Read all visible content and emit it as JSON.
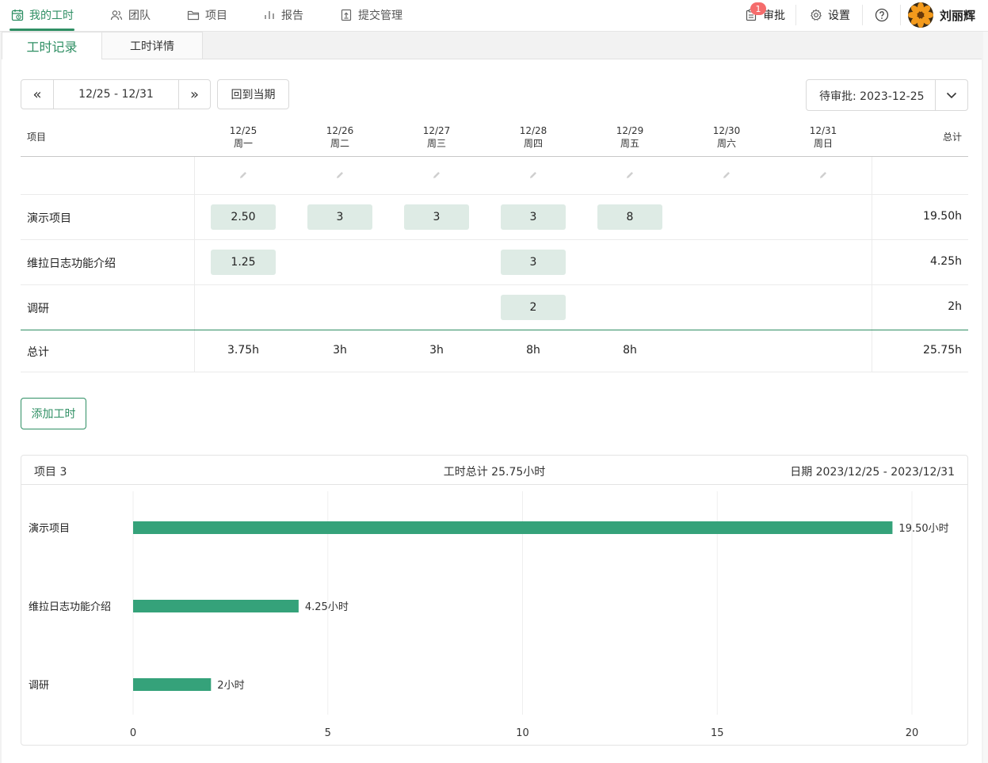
{
  "nav": {
    "items": [
      {
        "label": "我的工时",
        "icon": "calendar-clock-icon",
        "active": true
      },
      {
        "label": "团队",
        "icon": "users-icon"
      },
      {
        "label": "项目",
        "icon": "folder-icon"
      },
      {
        "label": "报告",
        "icon": "bar-chart-icon"
      },
      {
        "label": "提交管理",
        "icon": "submit-doc-icon"
      }
    ],
    "right": {
      "approval_label": "审批",
      "approval_badge": "1",
      "settings_label": "设置",
      "user_name": "刘丽辉"
    }
  },
  "tabs": [
    "工时记录",
    "工时详情"
  ],
  "toolbar": {
    "prev": "«",
    "range": "12/25 - 12/31",
    "next": "»",
    "current_label": "回到当期",
    "pending_label": "待审批: 2023-12-25"
  },
  "table": {
    "project_header": "项目",
    "total_header": "总计",
    "days": [
      {
        "date": "12/25",
        "weekday": "周一"
      },
      {
        "date": "12/26",
        "weekday": "周二"
      },
      {
        "date": "12/27",
        "weekday": "周三"
      },
      {
        "date": "12/28",
        "weekday": "周四"
      },
      {
        "date": "12/29",
        "weekday": "周五"
      },
      {
        "date": "12/30",
        "weekday": "周六"
      },
      {
        "date": "12/31",
        "weekday": "周日"
      }
    ],
    "rows": [
      {
        "name": "演示项目",
        "values": [
          "2.50",
          "3",
          "3",
          "3",
          "8",
          "",
          ""
        ],
        "total": "19.50h"
      },
      {
        "name": "维拉日志功能介绍",
        "values": [
          "1.25",
          "",
          "",
          "3",
          "",
          "",
          ""
        ],
        "total": "4.25h"
      },
      {
        "name": "调研",
        "values": [
          "",
          "",
          "",
          "2",
          "",
          "",
          ""
        ],
        "total": "2h"
      }
    ],
    "sum_label": "总计",
    "sums": [
      "3.75h",
      "3h",
      "3h",
      "8h",
      "8h",
      "",
      ""
    ],
    "grand_total": "25.75h"
  },
  "add_button": "添加工时",
  "summary": {
    "projects": "项目 3",
    "total": "工时总计 25.75小时",
    "dates": "日期 2023/12/25 - 2023/12/31"
  },
  "chart_data": {
    "type": "bar",
    "orientation": "horizontal",
    "categories": [
      "演示项目",
      "维拉日志功能介绍",
      "调研"
    ],
    "values": [
      19.5,
      4.25,
      2
    ],
    "value_labels": [
      "19.50小时",
      "4.25小时",
      "2小时"
    ],
    "xticks": [
      0,
      5,
      10,
      15,
      20
    ],
    "xlim": [
      0,
      20
    ],
    "grid": true,
    "color": "#35a27a"
  }
}
